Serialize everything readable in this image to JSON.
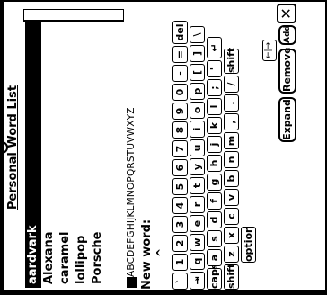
{
  "dialog": {
    "title": "Personal Word List"
  },
  "words": [
    {
      "label": "aardvark",
      "selected": true
    },
    {
      "label": "Alexana",
      "selected": false
    },
    {
      "label": "caramel",
      "selected": false
    },
    {
      "label": "lollipop",
      "selected": false
    },
    {
      "label": "Porsche",
      "selected": false
    }
  ],
  "alphabet_tabs": "ABCDEFGHIJKLMNOPQRSTUVWXYZ",
  "new_word": {
    "label": "New word:",
    "value": "",
    "caret": "^"
  },
  "keyboard": {
    "row1": [
      "`",
      "1",
      "2",
      "3",
      "4",
      "5",
      "6",
      "7",
      "8",
      "9",
      "0",
      "-",
      "=",
      "del"
    ],
    "row2": [
      "⇥",
      "q",
      "w",
      "e",
      "r",
      "t",
      "y",
      "u",
      "i",
      "o",
      "p",
      "[",
      "]",
      "\\"
    ],
    "row3": [
      "caps",
      "a",
      "s",
      "d",
      "f",
      "g",
      "h",
      "j",
      "k",
      "l",
      ";",
      "'",
      "↵"
    ],
    "row4": [
      "shift",
      "z",
      "x",
      "c",
      "v",
      "b",
      "n",
      "m",
      ",",
      ".",
      "/",
      "shift"
    ],
    "row5": [
      "option"
    ],
    "arrows": "←|→"
  },
  "buttons": {
    "expand": "Expand",
    "remove": "Remove",
    "add": "Add",
    "close": "✕"
  }
}
